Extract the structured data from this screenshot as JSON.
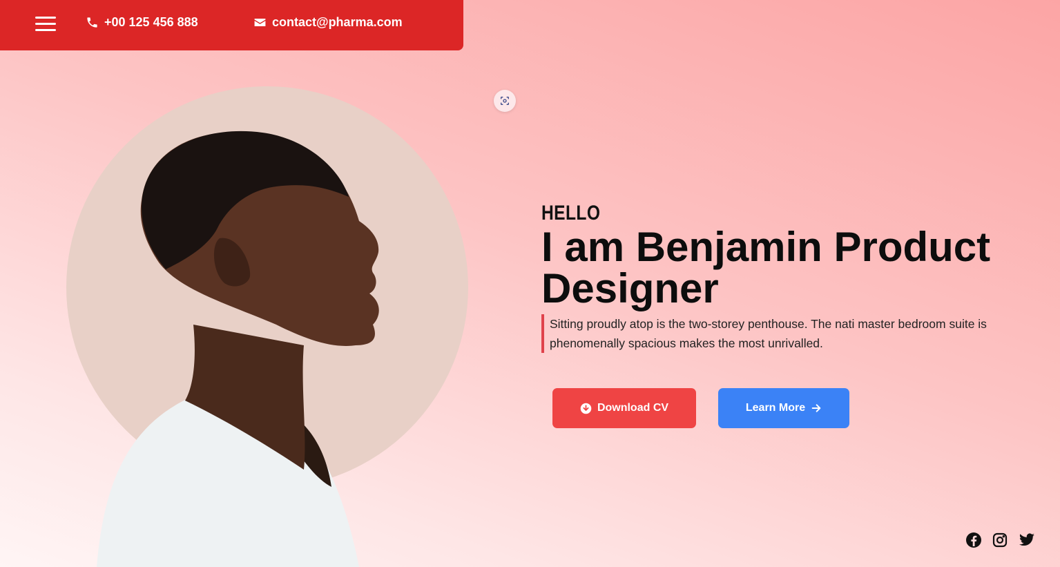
{
  "header": {
    "phone": "+00 125 456 888",
    "email": "contact@pharma.com",
    "background_color": "#dc2626"
  },
  "hero": {
    "greeting": "HELLO",
    "headline": "I am Benjamin Product Designer",
    "description": "Sitting proudly atop is the two-storey penthouse. The nati master bedroom suite is phenomenally spacious makes the most unrivalled.",
    "accent_color": "#e0424b"
  },
  "buttons": {
    "download": {
      "label": "Download CV",
      "icon": "download-circle-icon",
      "color": "#ef4444"
    },
    "learn_more": {
      "label": "Learn More",
      "icon": "arrow-right-icon",
      "color": "#3b82f6"
    }
  },
  "social": [
    "facebook-icon",
    "instagram-icon",
    "twitter-icon"
  ]
}
